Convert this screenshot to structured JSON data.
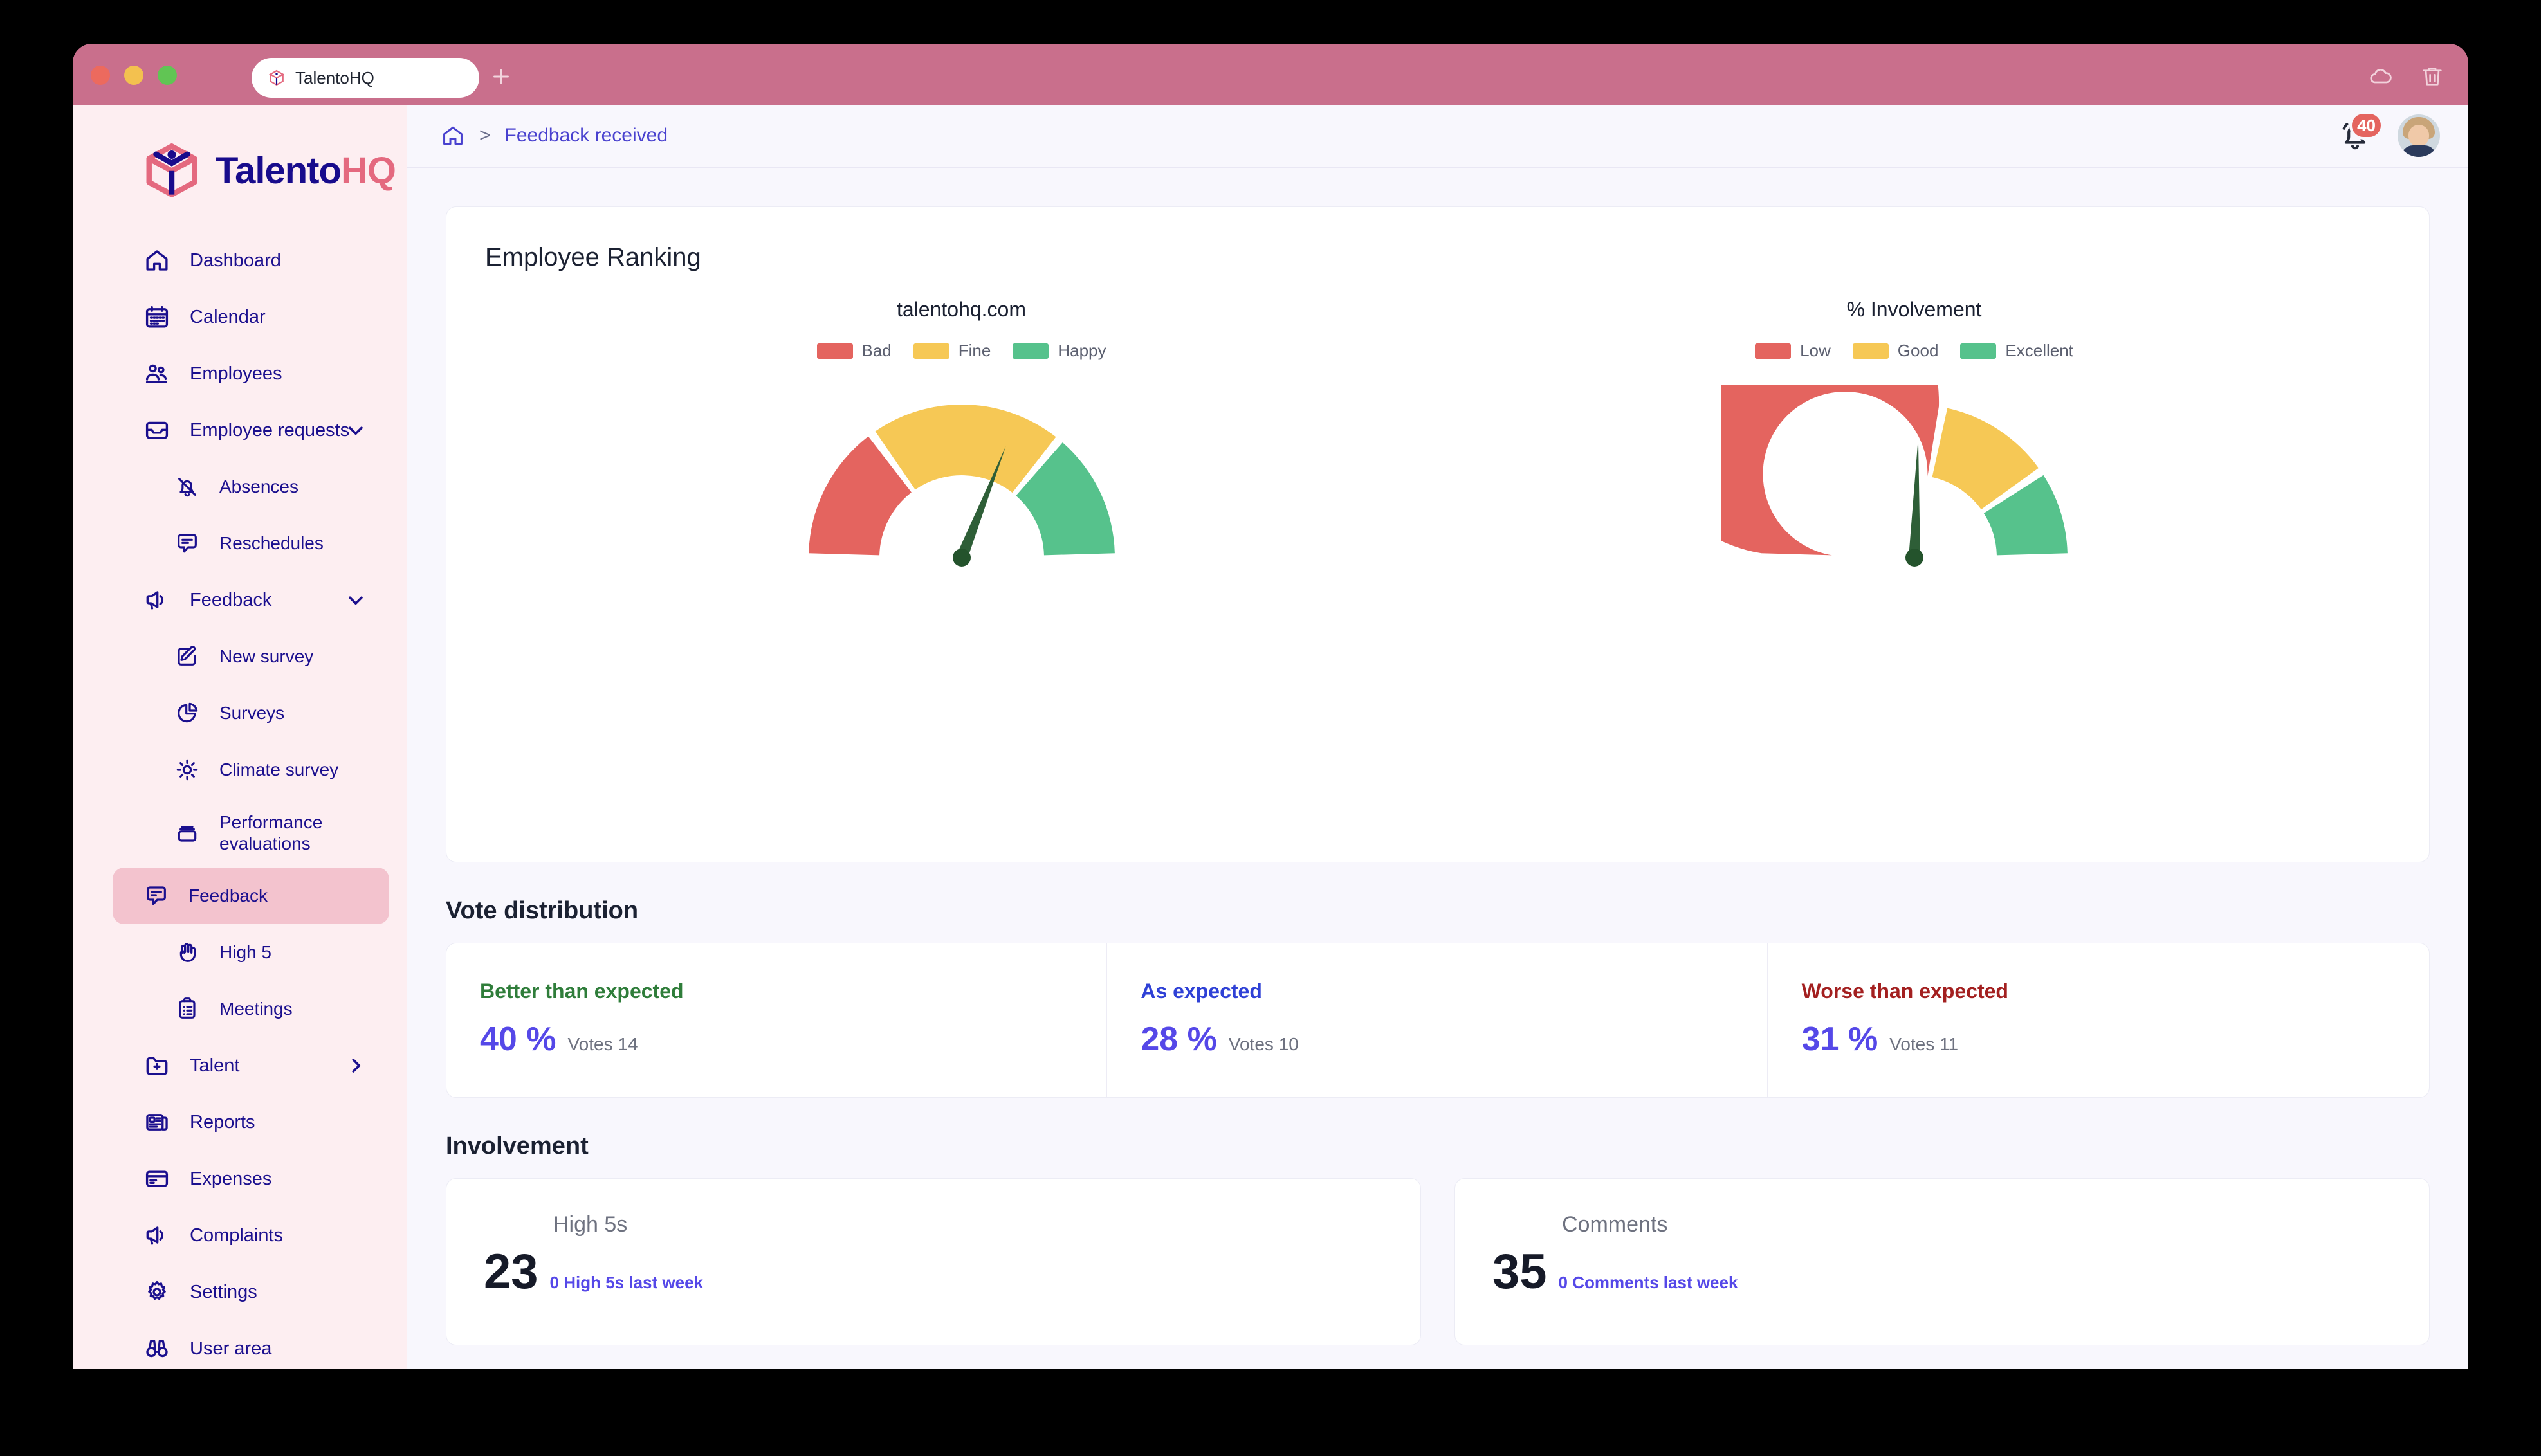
{
  "browser": {
    "tab_title": "TalentoHQ",
    "favicon_name": "talentohq-cube-icon",
    "new_tab_label": "+",
    "right_icons": [
      "cloud-icon",
      "trash-icon"
    ]
  },
  "brand": {
    "name_primary": "Talento",
    "name_secondary": "HQ"
  },
  "sidebar": {
    "items": [
      {
        "label": "Dashboard",
        "icon": "home-icon",
        "level": "top",
        "chevron": "",
        "active": false
      },
      {
        "label": "Calendar",
        "icon": "calendar-icon",
        "level": "top",
        "chevron": "",
        "active": false
      },
      {
        "label": "Employees",
        "icon": "people-icon",
        "level": "top",
        "chevron": "",
        "active": false
      },
      {
        "label": "Employee requests",
        "icon": "inbox-icon",
        "level": "top",
        "chevron": "down",
        "active": false
      },
      {
        "label": "Absences",
        "icon": "bell-off-icon",
        "level": "sub",
        "chevron": "",
        "active": false
      },
      {
        "label": "Reschedules",
        "icon": "chat-icon",
        "level": "sub",
        "chevron": "",
        "active": false
      },
      {
        "label": "Feedback",
        "icon": "megaphone-icon",
        "level": "top",
        "chevron": "down",
        "active": false
      },
      {
        "label": "New survey",
        "icon": "edit-icon",
        "level": "sub",
        "chevron": "",
        "active": false
      },
      {
        "label": "Surveys",
        "icon": "pie-chart-icon",
        "level": "sub",
        "chevron": "",
        "active": false
      },
      {
        "label": "Climate survey",
        "icon": "sun-icon",
        "level": "sub",
        "chevron": "",
        "active": false
      },
      {
        "label": "Performance evaluations",
        "icon": "archive-icon",
        "level": "sub",
        "chevron": "",
        "active": false
      },
      {
        "label": "Feedback",
        "icon": "chat-lines-icon",
        "level": "sub",
        "chevron": "",
        "active": true
      },
      {
        "label": "High 5",
        "icon": "hand-icon",
        "level": "sub",
        "chevron": "",
        "active": false
      },
      {
        "label": "Meetings",
        "icon": "clipboard-icon",
        "level": "sub",
        "chevron": "",
        "active": false
      },
      {
        "label": "Talent",
        "icon": "folder-plus-icon",
        "level": "top",
        "chevron": "right",
        "active": false
      },
      {
        "label": "Reports",
        "icon": "news-icon",
        "level": "top",
        "chevron": "",
        "active": false
      },
      {
        "label": "Expenses",
        "icon": "card-icon",
        "level": "top",
        "chevron": "",
        "active": false
      },
      {
        "label": "Complaints",
        "icon": "megaphone-icon",
        "level": "top",
        "chevron": "",
        "active": false
      },
      {
        "label": "Settings",
        "icon": "gear-icon",
        "level": "top",
        "chevron": "",
        "active": false
      },
      {
        "label": "User area",
        "icon": "binoculars-icon",
        "level": "top",
        "chevron": "",
        "active": false
      }
    ]
  },
  "topbar": {
    "home_icon": "home-icon",
    "separator": ">",
    "current": "Feedback received",
    "bell_icon": "bell-icon",
    "notification_count": "40",
    "avatar_name": "user-avatar"
  },
  "ranking": {
    "title": "Employee Ranking"
  },
  "vote_distribution": {
    "heading": "Vote distribution",
    "cards": [
      {
        "label": "Better than expected",
        "percent": "40",
        "percent_symbol": "%",
        "votes": "Votes 14"
      },
      {
        "label": "As expected",
        "percent": "28",
        "percent_symbol": "%",
        "votes": "Votes 10"
      },
      {
        "label": "Worse than expected",
        "percent": "31",
        "percent_symbol": "%",
        "votes": "Votes 11"
      }
    ]
  },
  "involvement": {
    "heading": "Involvement",
    "cards": [
      {
        "title": "High 5s",
        "number": "23",
        "subtitle": "0 High 5s last week"
      },
      {
        "title": "Comments",
        "number": "35",
        "subtitle": "0 Comments last week"
      }
    ]
  },
  "colors": {
    "bad_red": "#e4645f",
    "fine_yellow": "#f6c855",
    "happy_green": "#56c28c",
    "needle_green": "#2e5e37",
    "brand_indigo": "#180b8c",
    "brand_pink": "#e4697f",
    "accent_purple": "#5548e8"
  },
  "chart_data": [
    {
      "type": "gauge",
      "title": "talentohq.com",
      "legend": [
        {
          "label": "Bad",
          "color": "#e4645f"
        },
        {
          "label": "Fine",
          "color": "#f6c855"
        },
        {
          "label": "Happy",
          "color": "#56c28c"
        }
      ],
      "min": 0,
      "max": 100,
      "bands": [
        {
          "label": "Bad",
          "from": 0,
          "to": 30,
          "color": "#e4645f"
        },
        {
          "label": "Fine",
          "from": 30,
          "to": 72,
          "color": "#f6c855"
        },
        {
          "label": "Happy",
          "from": 72,
          "to": 100,
          "color": "#56c28c"
        }
      ],
      "value": 62,
      "needle_color": "#2e5e37"
    },
    {
      "type": "gauge",
      "title": "% Involvement",
      "legend": [
        {
          "label": "Low",
          "color": "#e4645f"
        },
        {
          "label": "Good",
          "color": "#f6c855"
        },
        {
          "label": "Excellent",
          "color": "#56c28c"
        }
      ],
      "min": 0,
      "max": 100,
      "bands": [
        {
          "label": "Low",
          "from": 0,
          "to": 56,
          "color": "#e4645f"
        },
        {
          "label": "Good",
          "from": 56,
          "to": 81,
          "color": "#f6c855"
        },
        {
          "label": "Excellent",
          "from": 81,
          "to": 100,
          "color": "#56c28c"
        }
      ],
      "value": 51,
      "needle_color": "#2e5e37"
    }
  ]
}
